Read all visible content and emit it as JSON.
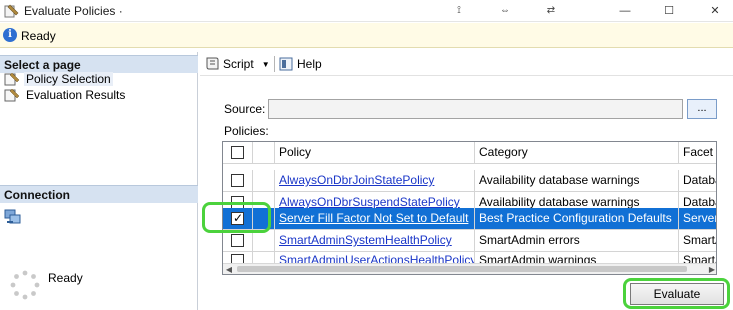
{
  "window": {
    "title": "Evaluate Policies ·",
    "controls": {
      "minimize": "—",
      "maximize": "☐",
      "close": "✕"
    },
    "extra_glyphs": [
      "⟟",
      "⇔",
      "⇄"
    ]
  },
  "status": {
    "icon": "info-icon",
    "text": "Ready"
  },
  "left_panel": {
    "select_page_header": "Select a page",
    "pages": [
      {
        "label": "Policy Selection",
        "icon": "page-icon",
        "selected": true
      },
      {
        "label": "Evaluation Results",
        "icon": "page-icon",
        "selected": false
      }
    ],
    "connection_header": "Connection",
    "connection_icon": "server-connection-icon",
    "progress_text": "Ready"
  },
  "toolbar": {
    "script_label": "Script",
    "help_label": "Help"
  },
  "source": {
    "label": "Source:",
    "value": "",
    "browse_label": "..."
  },
  "policies": {
    "label": "Policies:",
    "columns": [
      "",
      "",
      "Policy",
      "Category",
      "Facet"
    ],
    "rows": [
      {
        "checked": false,
        "policy": "AlwaysOnDbrJoinStatePolicy",
        "category": "Availability database warnings",
        "facet": "Databas",
        "selected": false
      },
      {
        "checked": false,
        "policy": "AlwaysOnDbrSuspendStatePolicy",
        "category": "Availability database warnings",
        "facet": "Databas",
        "selected": false
      },
      {
        "checked": true,
        "policy": "Server Fill Factor Not Set to Default",
        "category": "Best Practice Configuration Defaults",
        "facet": "Server C",
        "selected": true
      },
      {
        "checked": false,
        "policy": "SmartAdminSystemHealthPolicy",
        "category": "SmartAdmin errors",
        "facet": "SmartAd",
        "selected": false
      },
      {
        "checked": false,
        "policy": "SmartAdminUserActionsHealthPolicy",
        "category": "SmartAdmin warnings",
        "facet": "SmartAd",
        "selected": false
      }
    ]
  },
  "footer": {
    "evaluate_label": "Evaluate"
  },
  "colors": {
    "highlight": "#4bd23c",
    "selection": "#1170d5",
    "link": "#1a36c8"
  }
}
